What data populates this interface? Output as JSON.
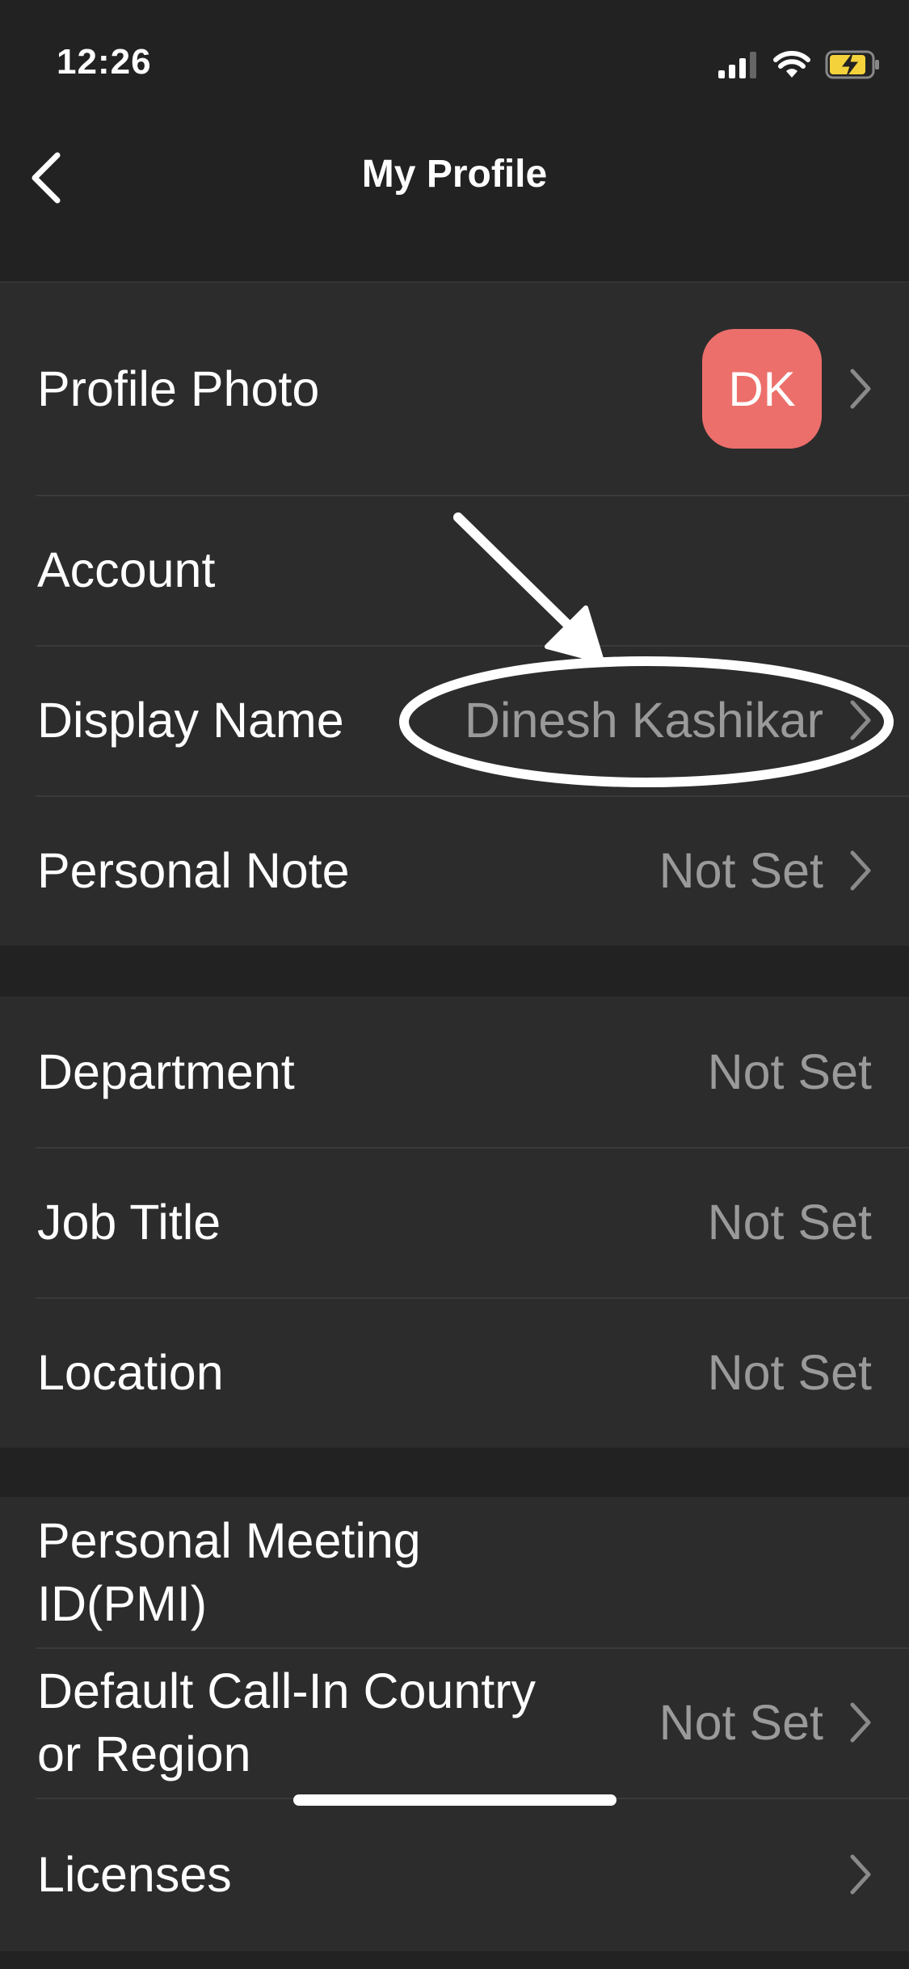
{
  "status_bar": {
    "time": "12:26",
    "icons": [
      "signal-icon",
      "wifi-icon",
      "battery-charging-icon"
    ],
    "battery_color": "#f4d23b"
  },
  "nav": {
    "title": "My Profile",
    "back_icon": "chevron-left-icon"
  },
  "groups": [
    {
      "rows": [
        {
          "label": "Profile Photo",
          "avatar_initials": "DK",
          "avatar_color": "#ec6f6b",
          "chevron": true
        },
        {
          "label": "Account"
        },
        {
          "label": "Display Name",
          "value": "Dinesh Kashikar",
          "chevron": true
        },
        {
          "label": "Personal Note",
          "value": "Not Set",
          "chevron": true
        }
      ]
    },
    {
      "rows": [
        {
          "label": "Department",
          "value": "Not Set"
        },
        {
          "label": "Job Title",
          "value": "Not Set"
        },
        {
          "label": "Location",
          "value": "Not Set"
        }
      ]
    },
    {
      "rows": [
        {
          "label": "Personal Meeting ID(PMI)"
        },
        {
          "label": "Default Call-In Country or Region",
          "value": "Not Set",
          "chevron": true
        },
        {
          "label": "Licenses",
          "chevron": true
        }
      ]
    }
  ],
  "colors": {
    "background": "#222222",
    "cell_background": "#2c2c2c",
    "label_text": "#ffffff",
    "value_text": "#9a9a9a",
    "annotation": "#ffffff"
  }
}
